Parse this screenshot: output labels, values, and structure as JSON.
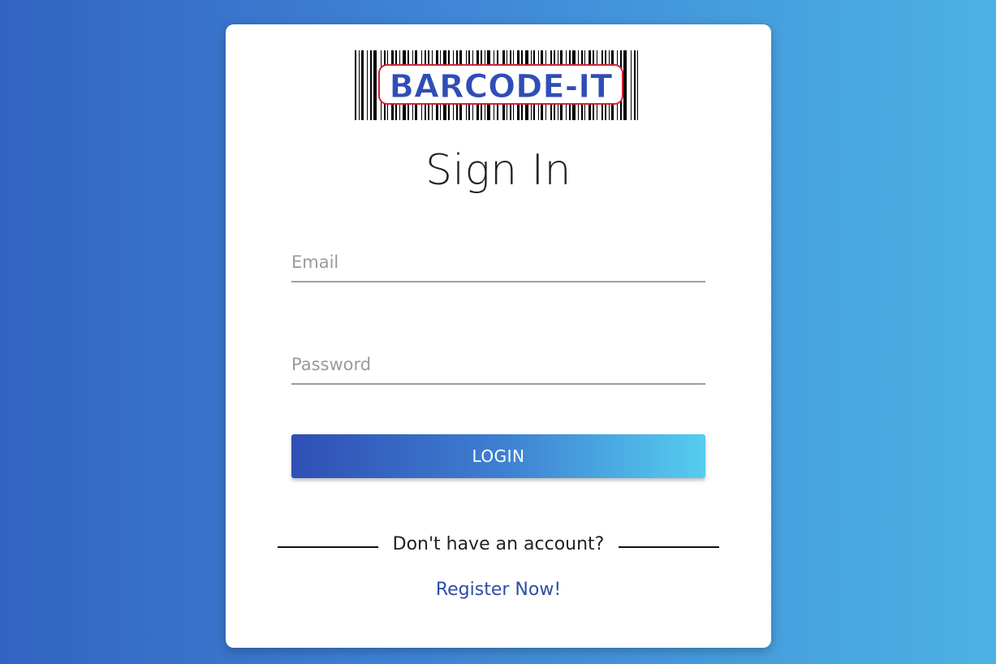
{
  "logo": {
    "text": "BARCODE-IT"
  },
  "form": {
    "title": "Sign In",
    "email_placeholder": "Email",
    "password_placeholder": "Password",
    "login_label": "LOGIN"
  },
  "footer": {
    "prompt": "Don't have an account?",
    "register_label": "Register Now!"
  },
  "colors": {
    "background_start": "#3363c2",
    "background_end": "#4cb2e4",
    "button_start": "#2f4fb5",
    "button_end": "#55cdf0",
    "link": "#2f4da8",
    "logo_text": "#2f4db8",
    "logo_outline": "#d2233a"
  }
}
